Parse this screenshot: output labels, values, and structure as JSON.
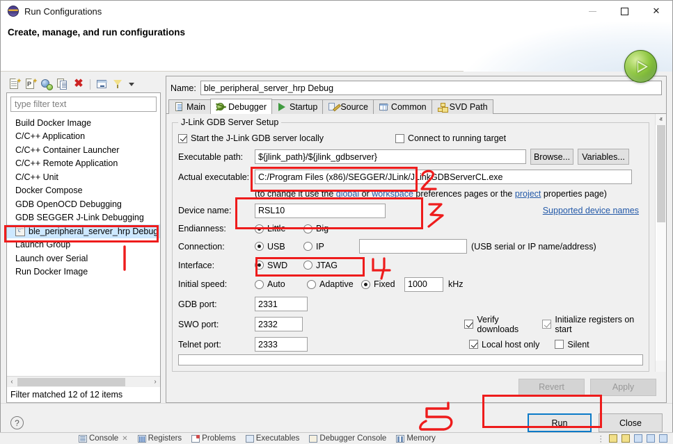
{
  "window": {
    "title": "Run Configurations",
    "title_icon": "eclipse-icon",
    "minimize": "minimize-icon",
    "maximize": "maximize-icon",
    "close": "close-icon"
  },
  "banner": {
    "heading": "Create, manage, and run configurations",
    "orb_icon": "run-orb-icon"
  },
  "left_pane": {
    "toolbar": [
      {
        "name": "new-launch-configuration-icon",
        "title": "New launch configuration"
      },
      {
        "name": "new-prototype-icon",
        "title": "New prototype"
      },
      {
        "name": "export-launch-configuration-icon",
        "title": "Export"
      },
      {
        "name": "duplicate-icon",
        "title": "Duplicate"
      },
      {
        "name": "delete-icon",
        "title": "Delete"
      },
      {
        "name": "collapse-all-icon",
        "title": "Collapse All"
      },
      {
        "name": "filter-icon",
        "title": "Filter"
      },
      {
        "name": "view-menu-icon",
        "title": "View Menu"
      }
    ],
    "filter_placeholder": "type filter text",
    "filter_value": "",
    "items": [
      {
        "label": "Build Docker Image",
        "selected": false,
        "has_icon": false
      },
      {
        "label": "C/C++ Application",
        "selected": false,
        "has_icon": false
      },
      {
        "label": "C/C++ Container Launcher",
        "selected": false,
        "has_icon": false
      },
      {
        "label": "C/C++ Remote Application",
        "selected": false,
        "has_icon": false
      },
      {
        "label": "C/C++ Unit",
        "selected": false,
        "has_icon": false
      },
      {
        "label": "Docker Compose",
        "selected": false,
        "has_icon": false
      },
      {
        "label": "GDB OpenOCD Debugging",
        "selected": false,
        "has_icon": false
      },
      {
        "label": "GDB SEGGER J-Link Debugging",
        "selected": false,
        "has_icon": false
      },
      {
        "label": "ble_peripheral_server_hrp Debug",
        "selected": true,
        "has_icon": true
      },
      {
        "label": "Launch Group",
        "selected": false,
        "has_icon": false
      },
      {
        "label": "Launch over Serial",
        "selected": false,
        "has_icon": false
      },
      {
        "label": "Run Docker Image",
        "selected": false,
        "has_icon": false
      }
    ],
    "status": "Filter matched 12 of 12 items",
    "hscroll_left": "‹",
    "hscroll_right": "›"
  },
  "right_pane": {
    "name_label": "Name:",
    "name_value": "ble_peripheral_server_hrp Debug",
    "tabs": [
      {
        "label": "Main",
        "icon": "main-tab-icon",
        "active": false
      },
      {
        "label": "Debugger",
        "icon": "debugger-tab-icon",
        "active": true
      },
      {
        "label": "Startup",
        "icon": "startup-tab-icon",
        "active": false
      },
      {
        "label": "Source",
        "icon": "source-tab-icon",
        "active": false
      },
      {
        "label": "Common",
        "icon": "common-tab-icon",
        "active": false
      },
      {
        "label": "SVD Path",
        "icon": "svd-path-tab-icon",
        "active": false
      }
    ],
    "group_title": "J-Link GDB Server Setup",
    "start_server_label": "Start the J-Link GDB server locally",
    "start_server_checked": true,
    "connect_running_label": "Connect to running target",
    "connect_running_checked": false,
    "executable_path_label": "Executable path:",
    "executable_path_value": "${jlink_path}/${jlink_gdbserver}",
    "browse_label": "Browse...",
    "variables_label": "Variables...",
    "actual_executable_label": "Actual executable:",
    "actual_executable_value": "C:/Program Files (x86)/SEGGER/JLink/JLinkGDBServerCL.exe",
    "hint_prefix": "(to change it use the ",
    "hint_link_global": "global",
    "hint_mid1": " or ",
    "hint_link_workspace": "workspace",
    "hint_mid2": " preferences pages or the ",
    "hint_link_project": "project",
    "hint_suffix": " properties page)",
    "device_name_label": "Device name:",
    "device_name_value": "RSL10",
    "supported_device_names": "Supported device names",
    "endianness_label": "Endianness:",
    "endianness_options": [
      {
        "label": "Little",
        "selected": true
      },
      {
        "label": "Big",
        "selected": false
      }
    ],
    "connection_label": "Connection:",
    "connection_options": [
      {
        "label": "USB",
        "selected": true
      },
      {
        "label": "IP",
        "selected": false
      }
    ],
    "connection_value": "",
    "connection_hint": "(USB serial or IP name/address)",
    "interface_label": "Interface:",
    "interface_options": [
      {
        "label": "SWD",
        "selected": true
      },
      {
        "label": "JTAG",
        "selected": false
      }
    ],
    "initial_speed_label": "Initial speed:",
    "initial_speed_options": [
      {
        "label": "Auto",
        "selected": false
      },
      {
        "label": "Adaptive",
        "selected": false
      },
      {
        "label": "Fixed",
        "selected": true
      }
    ],
    "initial_speed_value": "1000",
    "initial_speed_unit": "kHz",
    "gdb_port_label": "GDB port:",
    "gdb_port_value": "2331",
    "swo_port_label": "SWO port:",
    "swo_port_value": "2332",
    "telnet_port_label": "Telnet port:",
    "telnet_port_value": "2333",
    "verify_downloads_label": "Verify downloads",
    "verify_downloads_checked": true,
    "init_registers_label": "Initialize registers on start",
    "init_registers_checked": true,
    "local_host_only_label": "Local host only",
    "local_host_only_checked": true,
    "silent_label": "Silent",
    "silent_checked": false,
    "revert_label": "Revert",
    "apply_label": "Apply",
    "scroll_up": "ⱏ",
    "scroll_down": "ⱟ"
  },
  "footer": {
    "help_icon": "help-icon",
    "help_glyph": "?",
    "run_label": "Run",
    "close_label": "Close"
  },
  "eclipse_strip": {
    "tabs": [
      {
        "label": "Console",
        "icon": "console-icon",
        "closable": true
      },
      {
        "label": "Registers",
        "icon": "registers-icon",
        "closable": false
      },
      {
        "label": "Problems",
        "icon": "problems-icon",
        "closable": false
      },
      {
        "label": "Executables",
        "icon": "executables-icon",
        "closable": false
      },
      {
        "label": "Debugger Console",
        "icon": "debugger-console-icon",
        "closable": false
      },
      {
        "label": "Memory",
        "icon": "memory-icon",
        "closable": false
      }
    ]
  },
  "annotations": {
    "color": "#ee1c1c",
    "marks": [
      {
        "name": "annotation-1",
        "text": "1",
        "target": "selected-configuration"
      },
      {
        "name": "annotation-2",
        "text": "2",
        "target": "actual-executable-field"
      },
      {
        "name": "annotation-3",
        "text": "3",
        "target": "device-name-field"
      },
      {
        "name": "annotation-4",
        "text": "4",
        "target": "interface-swd-radio"
      },
      {
        "name": "annotation-5",
        "text": "5",
        "target": "run-button"
      }
    ]
  }
}
